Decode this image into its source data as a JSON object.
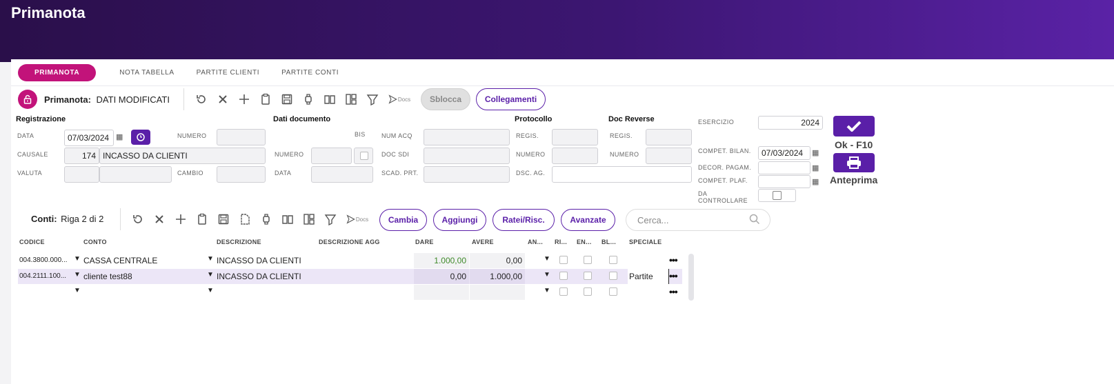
{
  "app": {
    "title": "Primanota"
  },
  "tabs": [
    {
      "label": "PRIMANOTA"
    },
    {
      "label": "NOTA TABELLA"
    },
    {
      "label": "PARTITE CLIENTI"
    },
    {
      "label": "PARTITE CONTI"
    }
  ],
  "toolbar": {
    "label": "Primanota:",
    "status": "DATI MODIFICATI",
    "docs_label": "Docs",
    "sblocca": "Sblocca",
    "collegamenti": "Collegamenti"
  },
  "registrazione": {
    "title": "Registrazione",
    "data_label": "DATA",
    "data_value": "07/03/2024",
    "numero_label": "NUMERO",
    "numero_value": "",
    "causale_label": "CAUSALE",
    "causale_code": "174",
    "causale_desc": "INCASSO DA CLIENTI",
    "valuta_label": "VALUTA",
    "cambio_label": "CAMBIO"
  },
  "dati_documento": {
    "title": "Dati documento",
    "bis_label": "BIS",
    "numero_label": "NUMERO",
    "data_label": "DATA",
    "num_acq_label": "NUM ACQ",
    "doc_sdi_label": "DOC SDI",
    "scad_prt_label": "SCAD. PRT."
  },
  "protocollo": {
    "title": "Protocollo",
    "regis_label": "REGIS.",
    "numero_label": "NUMERO",
    "dsc_ag_label": "DSC. AG."
  },
  "doc_reverse": {
    "title": "Doc Reverse",
    "regis_label": "REGIS.",
    "numero_label": "NUMERO"
  },
  "esercizio": {
    "esercizio_label": "ESERCIZIO",
    "esercizio_value": "2024",
    "compet_bilan_label": "COMPET. BILAN.",
    "compet_bilan_value": "07/03/2024",
    "decor_pagam_label": "DECOR. PAGAM.",
    "compet_plaf_label": "COMPET. PLAF.",
    "da_controllare_label": "DA CONTROLLARE"
  },
  "actions": {
    "ok_label": "Ok - F10",
    "anteprima_label": "Anteprima"
  },
  "conti": {
    "label": "Conti:",
    "riga": "Riga 2 di 2",
    "docs_label": "Docs",
    "cambia": "Cambia",
    "aggiungi": "Aggiungi",
    "ratei": "Ratei/Risc.",
    "avanzate": "Avanzate",
    "search_placeholder": "Cerca..."
  },
  "grid": {
    "headers": [
      "CODICE",
      "CONTO",
      "DESCRIZIONE",
      "DESCRIZIONE AGG",
      "DARE",
      "AVERE",
      "AN...",
      "RI...",
      "EN...",
      "BL...",
      "SPECIALE"
    ],
    "rows": [
      {
        "codice": "004.3800.000...",
        "conto": "CASSA CENTRALE",
        "descrizione": "INCASSO DA CLIENTI",
        "descrizione_agg": "",
        "dare": "1.000,00",
        "avere": "0,00",
        "speciale": ""
      },
      {
        "codice": "004.2111.100...",
        "conto": "cliente test88",
        "descrizione": "INCASSO DA CLIENTI",
        "descrizione_agg": "",
        "dare": "0,00",
        "avere": "1.000,00",
        "speciale": "Partite"
      },
      {
        "codice": "",
        "conto": "",
        "descrizione": "",
        "descrizione_agg": "",
        "dare": "",
        "avere": "",
        "speciale": ""
      }
    ]
  },
  "colors": {
    "header_start": "#2a0f4a",
    "header_end": "#5a22a6",
    "accent": "#c2137a",
    "primary": "#5a1fa8"
  }
}
